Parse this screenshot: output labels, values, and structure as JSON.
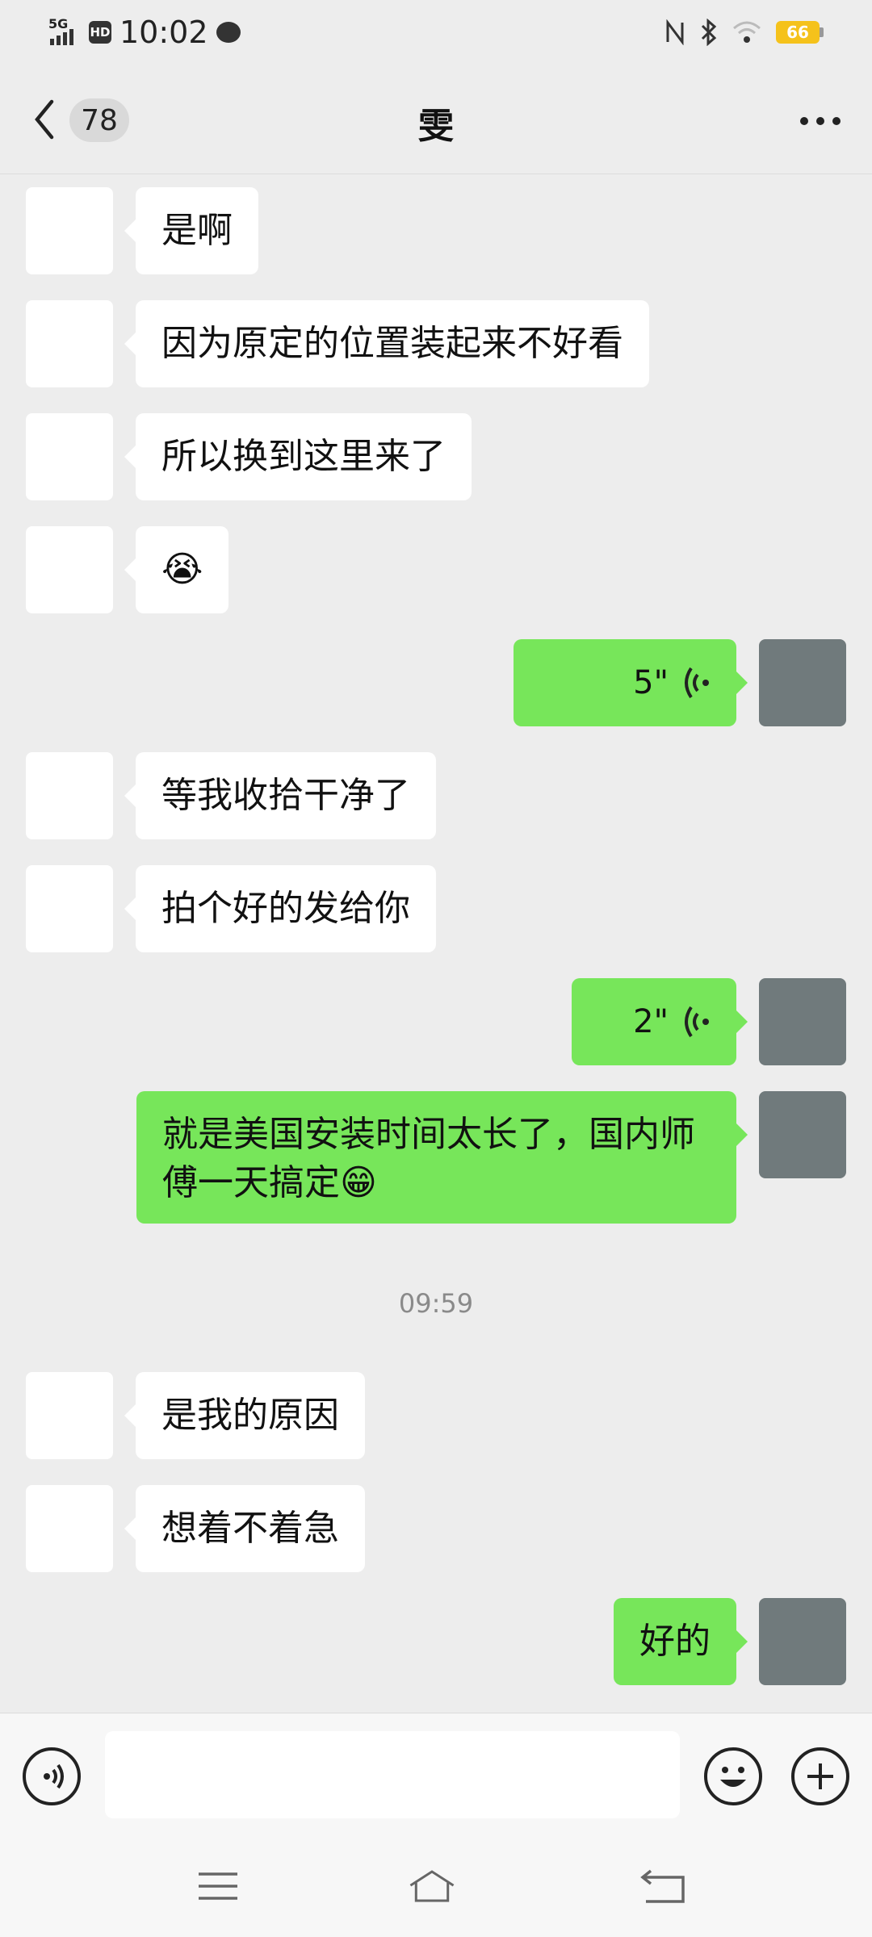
{
  "status_bar": {
    "time": "10:02",
    "network": "5G",
    "hd": "HD",
    "battery": "66"
  },
  "header": {
    "unread_count": "78",
    "title": "雯"
  },
  "messages": [
    {
      "from": "her",
      "text": "是啊"
    },
    {
      "from": "her",
      "text": "因为原定的位置装起来不好看"
    },
    {
      "from": "her",
      "text": "所以换到这里来了"
    },
    {
      "from": "her",
      "text": "😭"
    },
    {
      "from": "me",
      "type": "voice",
      "duration": "5\""
    },
    {
      "from": "her",
      "text": "等我收拾干净了"
    },
    {
      "from": "her",
      "text": "拍个好的发给你"
    },
    {
      "from": "me",
      "type": "voice",
      "duration": "2\""
    },
    {
      "from": "me",
      "text": "就是美国安装时间太长了，国内师傅一天搞定😁"
    },
    {
      "from": "her",
      "text": "是我的原因"
    },
    {
      "from": "her",
      "text": "想着不着急"
    },
    {
      "from": "me",
      "text": "好的"
    }
  ],
  "time_label": "09:59",
  "input": {
    "value": "",
    "placeholder": ""
  },
  "icons": {
    "voice_input": "voice-input-icon",
    "emoji": "emoji-icon",
    "plus": "plus-icon",
    "back": "back-arrow-icon",
    "more": "more-dots-icon"
  },
  "colors": {
    "outgoing_bubble": "#77e65a",
    "incoming_bubble": "#ffffff",
    "background": "#ededed"
  }
}
